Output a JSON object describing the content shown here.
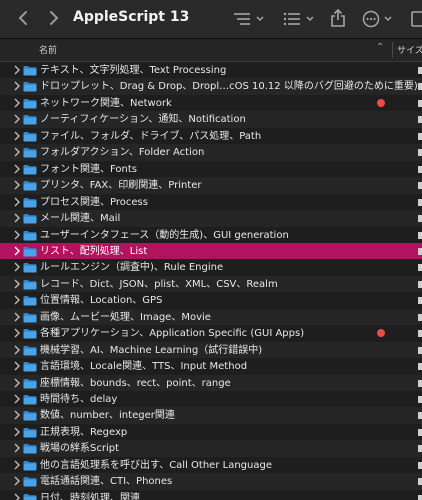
{
  "window": {
    "title": "AppleScript 13"
  },
  "columns": {
    "name": "名前",
    "size": "サイズ"
  },
  "colors": {
    "selected": "#b3125f",
    "tag_red": "#ec4b4b",
    "folder": "#4aa3e6"
  },
  "rows": [
    {
      "label": "テキスト、文字列処理、Text Processing",
      "tag": false,
      "selected": false
    },
    {
      "label": "ドロップレット、Drag & Drop、Dropl…cOS 10.12 以降のバグ回避のために重要)",
      "tag": false,
      "selected": false
    },
    {
      "label": "ネットワーク関連、Network",
      "tag": true,
      "selected": false
    },
    {
      "label": "ノーティフィケーション、通知、Notification",
      "tag": false,
      "selected": false
    },
    {
      "label": "ファイル、フォルダ、ドライブ、パス処理、Path",
      "tag": false,
      "selected": false
    },
    {
      "label": "フォルダアクション、Folder Action",
      "tag": false,
      "selected": false
    },
    {
      "label": "フォント関連、Fonts",
      "tag": false,
      "selected": false
    },
    {
      "label": "プリンタ、FAX、印刷関連、Printer",
      "tag": false,
      "selected": false
    },
    {
      "label": "プロセス関連、Process",
      "tag": false,
      "selected": false
    },
    {
      "label": "メール関連、Mail",
      "tag": false,
      "selected": false
    },
    {
      "label": "ユーザーインタフェース（動的生成)、GUI generation",
      "tag": false,
      "selected": false
    },
    {
      "label": "リスト、配列処理、List",
      "tag": false,
      "selected": true
    },
    {
      "label": "ルールエンジン（調査中)、Rule Engine",
      "tag": false,
      "selected": false
    },
    {
      "label": "レコード、Dict、JSON、plist、XML、CSV、Realm",
      "tag": false,
      "selected": false
    },
    {
      "label": "位置情報、Location、GPS",
      "tag": false,
      "selected": false
    },
    {
      "label": "画像、ムービー処理、Image、Movie",
      "tag": false,
      "selected": false
    },
    {
      "label": "各種アプリケーション、Application Specific (GUI Apps)",
      "tag": true,
      "selected": false
    },
    {
      "label": "機械学習、AI、Machine Learning（試行錯誤中)",
      "tag": false,
      "selected": false
    },
    {
      "label": "言語環境、Locale関連、TTS、Input Method",
      "tag": false,
      "selected": false
    },
    {
      "label": "座標情報、bounds、rect、point、range",
      "tag": false,
      "selected": false
    },
    {
      "label": "時間待ち、delay",
      "tag": false,
      "selected": false
    },
    {
      "label": "数値、number、integer関連",
      "tag": false,
      "selected": false
    },
    {
      "label": "正規表現、Regexp",
      "tag": false,
      "selected": false
    },
    {
      "label": "戦場の絆系Script",
      "tag": false,
      "selected": false
    },
    {
      "label": "他の言語処理系を呼び出す、Call Other Language",
      "tag": false,
      "selected": false
    },
    {
      "label": "電話通話関連、CTI、Phones",
      "tag": false,
      "selected": false
    },
    {
      "label": "日付、時刻処理、関連",
      "tag": false,
      "selected": false
    }
  ]
}
